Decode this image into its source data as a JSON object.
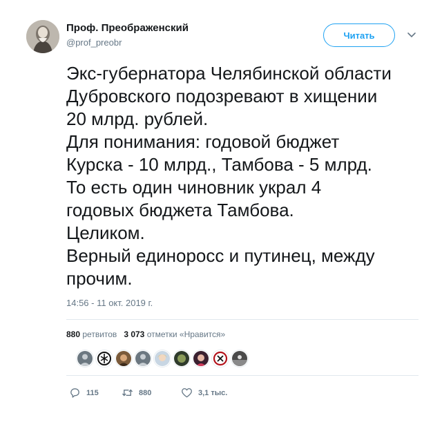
{
  "author": {
    "display_name": "Проф. Преображенский",
    "handle": "@prof_preobr"
  },
  "follow_button_label": "Читать",
  "tweet": {
    "lines": [
      "Экс-губернатора Челябинской области",
      "Дубровского подозревают в хищении",
      "20 млрд. рублей.",
      "Для понимания: годовой бюджет",
      "Курска - 10 млрд., Тамбова - 5 млрд.",
      "То есть один чиновник украл 4",
      "годовых бюджета Тамбова.",
      "Целиком.",
      "Верный единоросс и путинец, между",
      "прочим."
    ],
    "timestamp": "14:56 - 11 окт. 2019 г."
  },
  "stats": {
    "retweets_count": "880",
    "retweets_label": "ретвитов",
    "likes_count": "3 073",
    "likes_label": "отметки «Нравится»"
  },
  "actions": {
    "replies": "115",
    "retweets": "880",
    "likes": "3,1 тыс."
  },
  "colors": {
    "accent": "#1da1f2",
    "secondary_text": "#657786",
    "divider": "#e1e8ed"
  }
}
